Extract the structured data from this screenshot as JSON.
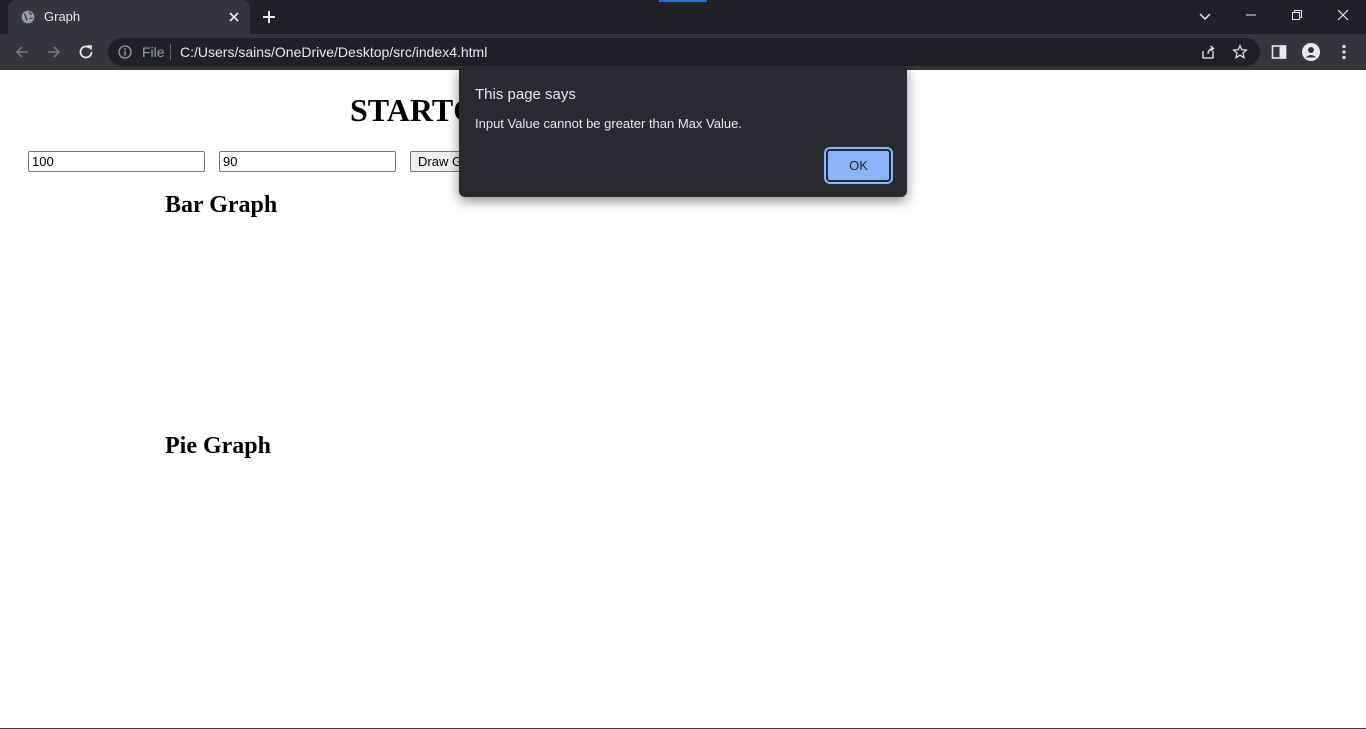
{
  "browser": {
    "tab_title": "Graph",
    "address": {
      "scheme_label": "File",
      "url": "C:/Users/sains/OneDrive/Desktop/src/index4.html"
    },
    "icons": [
      "globe-icon",
      "close-icon",
      "plus-icon",
      "chevron-down-icon",
      "minimize-icon",
      "restore-icon",
      "close-window-icon",
      "back-icon",
      "forward-icon",
      "reload-icon",
      "info-icon",
      "share-icon",
      "star-icon",
      "side-panel-icon",
      "profile-icon",
      "kebab-menu-icon"
    ],
    "colors": {
      "frame": "#202124",
      "toolbar": "#35363a",
      "accent": "#8ab4f8"
    }
  },
  "page": {
    "heading": "STARTC",
    "inputs": [
      {
        "value": "100"
      },
      {
        "value": "90"
      }
    ],
    "draw_button_label": "Draw G",
    "bar_heading": "Bar Graph",
    "pie_heading": "Pie Graph"
  },
  "dialog": {
    "title": "This page says",
    "message": "Input Value cannot be greater than Max Value.",
    "ok_label": "OK"
  }
}
